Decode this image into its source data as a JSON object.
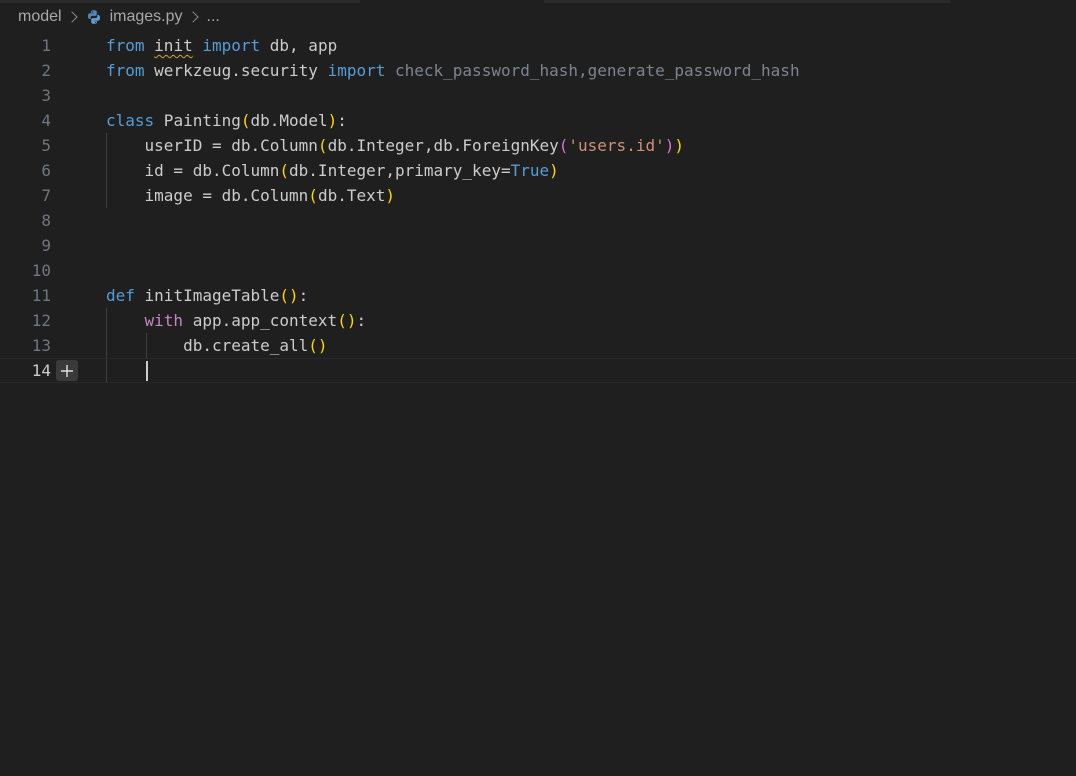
{
  "breadcrumb": {
    "folder": "model",
    "file": "images.py",
    "more": "...",
    "file_icon": "python-icon"
  },
  "editor": {
    "current_line": 14,
    "lines": [
      {
        "n": "1",
        "segs": [
          [
            "kw",
            "from"
          ],
          [
            "",
            "  "
          ],
          [
            "sq",
            "init"
          ],
          [
            "",
            " "
          ],
          [
            "kw",
            "import"
          ],
          [
            "",
            " db, app"
          ]
        ]
      },
      {
        "n": "2",
        "segs": [
          [
            "kw",
            "from"
          ],
          [
            "",
            " werkzeug.security "
          ],
          [
            "kw",
            "import"
          ],
          [
            "dim",
            " check_password_hash,generate_password_hash"
          ]
        ]
      },
      {
        "n": "3",
        "segs": []
      },
      {
        "n": "4",
        "segs": [
          [
            "kw",
            "class"
          ],
          [
            "",
            " Painting"
          ],
          [
            "p1",
            "("
          ],
          [
            "",
            "db.Model"
          ],
          [
            "p1",
            ")"
          ],
          [
            "",
            ":"
          ]
        ]
      },
      {
        "n": "5",
        "segs": [
          [
            "",
            "    userID = db.Column"
          ],
          [
            "p1",
            "("
          ],
          [
            "",
            "db.Integer,db.ForeignKey"
          ],
          [
            "p2",
            "("
          ],
          [
            "str",
            "'users.id'"
          ],
          [
            "p2",
            ")"
          ],
          [
            "p1",
            ")"
          ]
        ]
      },
      {
        "n": "6",
        "segs": [
          [
            "",
            "    id = db.Column"
          ],
          [
            "p1",
            "("
          ],
          [
            "",
            "db.Integer,primary_key="
          ],
          [
            "kw",
            "True"
          ],
          [
            "p1",
            ")"
          ]
        ]
      },
      {
        "n": "7",
        "segs": [
          [
            "",
            "    image = db.Column"
          ],
          [
            "p1",
            "("
          ],
          [
            "",
            "db.Text"
          ],
          [
            "p1",
            ")"
          ]
        ]
      },
      {
        "n": "8",
        "segs": []
      },
      {
        "n": "9",
        "segs": []
      },
      {
        "n": "10",
        "segs": []
      },
      {
        "n": "11",
        "segs": [
          [
            "kw",
            "def"
          ],
          [
            "",
            " initImageTable"
          ],
          [
            "p1",
            "()"
          ],
          [
            "",
            ":"
          ]
        ]
      },
      {
        "n": "12",
        "segs": [
          [
            "",
            "    "
          ],
          [
            "kw2",
            "with"
          ],
          [
            "",
            " app.app_context"
          ],
          [
            "p1",
            "()"
          ],
          [
            "",
            ":"
          ]
        ]
      },
      {
        "n": "13",
        "segs": [
          [
            "",
            "        db.create_all"
          ],
          [
            "p1",
            "()"
          ]
        ]
      },
      {
        "n": "14",
        "segs": []
      }
    ]
  },
  "gutter": {
    "add_icon": "plus-icon"
  }
}
